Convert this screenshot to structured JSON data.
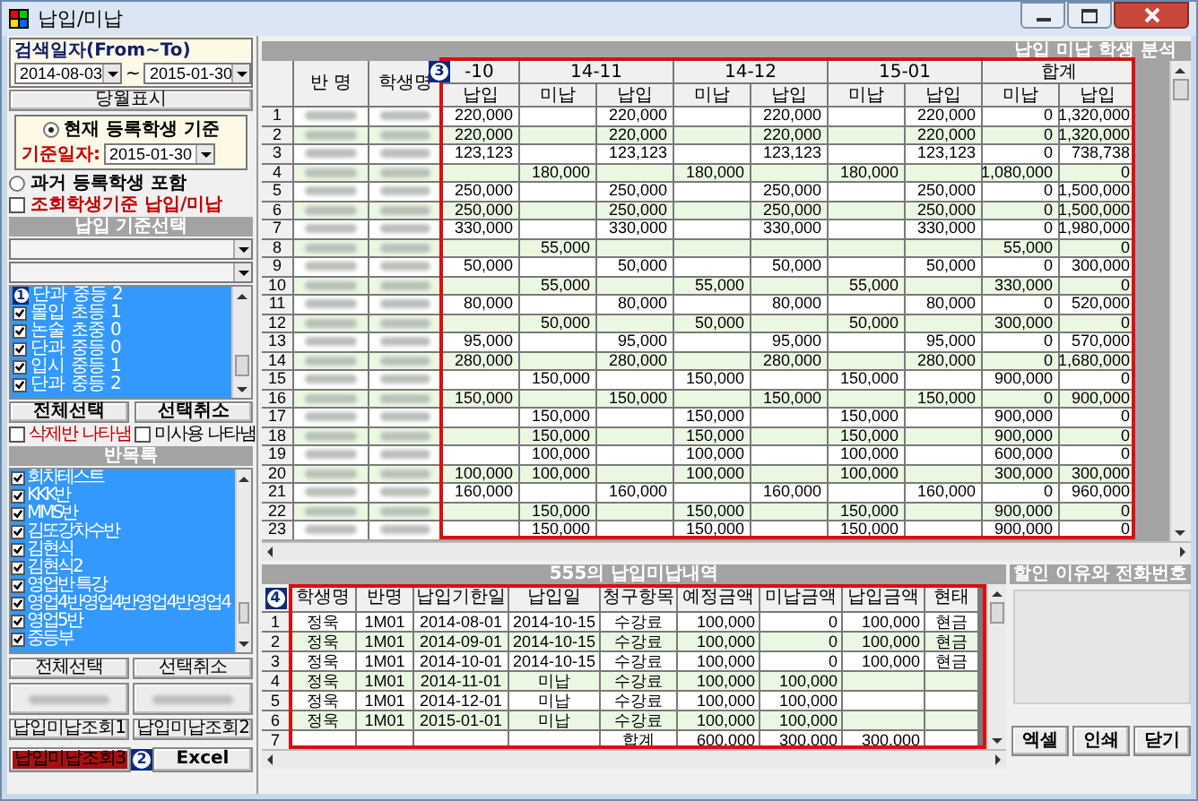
{
  "window": {
    "title": "납입/미납"
  },
  "search": {
    "label": "검색일자(From~To)",
    "from": "2014-08-03",
    "separator": "~",
    "to": "2015-01-30"
  },
  "month_button": "당월표시",
  "criteria": {
    "current": {
      "label": "현재 등록학생 기준",
      "selected": true
    },
    "date_label": "기준일자:",
    "date": "2015-01-30"
  },
  "past": {
    "label": "과거 등록학생 포함",
    "selected": false
  },
  "query_check": {
    "label": "조회학생기준 납입/미납",
    "checked": false
  },
  "payment_header": "납입 기준선택",
  "course_list": {
    "marker": "1",
    "items": [
      {
        "label": "단과 중등 2"
      },
      {
        "label": "몰입 초등 1",
        "checked": true
      },
      {
        "label": "논술 초중 0",
        "checked": true
      },
      {
        "label": "단과 중등 0",
        "checked": true
      },
      {
        "label": "입시 중등 1",
        "checked": true
      },
      {
        "label": "단과 중등 2",
        "checked": true
      }
    ]
  },
  "course_buttons": [
    "전체선택",
    "선택취소"
  ],
  "show_options": [
    {
      "label": "삭제반 나타냄",
      "checked": false,
      "kind": "warning"
    },
    {
      "label": "미사용 나타냄",
      "checked": false,
      "kind": "normal"
    }
  ],
  "class_header": "반목록",
  "class_list": [
    {
      "label": "회차테스트",
      "checked": true
    },
    {
      "label": "KKK반",
      "checked": true
    },
    {
      "label": "MMS반",
      "checked": true
    },
    {
      "label": "김또강차수반",
      "checked": true
    },
    {
      "label": "김현식",
      "checked": true
    },
    {
      "label": "김현식2",
      "checked": true
    },
    {
      "label": "영업반 특강",
      "checked": true
    },
    {
      "label": "영업4반영업4반영업4반영업4",
      "checked": true
    },
    {
      "label": "영업5반",
      "checked": true
    },
    {
      "label": "중등부",
      "checked": true
    }
  ],
  "class_buttons": [
    {
      "label": "전체선택",
      "kind": "normal"
    },
    {
      "label": "선택취소",
      "kind": "normal"
    },
    {
      "kind": "blurred"
    },
    {
      "kind": "blurred"
    },
    {
      "label": "납입미납조회1",
      "kind": "normal"
    },
    {
      "label": "납입미납조회2",
      "kind": "normal"
    }
  ],
  "query_button": "납입미납조회3",
  "excel_marker": "2",
  "excel_button": "Excel",
  "analysis": {
    "title": "납입 미납 학생 분석",
    "marker": "3",
    "fixed_columns": [
      "반 명",
      "학생명"
    ],
    "months": [
      {
        "label": "-10",
        "subs": [
          "납입"
        ]
      },
      {
        "label": "14-11",
        "subs": [
          "미납",
          "납입"
        ]
      },
      {
        "label": "14-12",
        "subs": [
          "미납",
          "납입"
        ]
      },
      {
        "label": "15-01",
        "subs": [
          "미납",
          "납입"
        ]
      },
      {
        "label": "합계",
        "subs": [
          "미납",
          "납입"
        ]
      }
    ],
    "rows": [
      [
        "1",
        [
          "220,000",
          null,
          "220,000",
          null,
          "220,000",
          null,
          "220,000",
          "0",
          "1,320,000"
        ]
      ],
      [
        "2",
        [
          "220,000",
          null,
          "220,000",
          null,
          "220,000",
          null,
          "220,000",
          "0",
          "1,320,000"
        ]
      ],
      [
        "3",
        [
          "123,123",
          null,
          "123,123",
          null,
          "123,123",
          null,
          "123,123",
          "0",
          "738,738"
        ]
      ],
      [
        "4",
        [
          null,
          "180,000",
          null,
          "180,000",
          null,
          "180,000",
          null,
          "1,080,000",
          "0"
        ]
      ],
      [
        "5",
        [
          "250,000",
          null,
          "250,000",
          null,
          "250,000",
          null,
          "250,000",
          "0",
          "1,500,000"
        ]
      ],
      [
        "6",
        [
          "250,000",
          null,
          "250,000",
          null,
          "250,000",
          null,
          "250,000",
          "0",
          "1,500,000"
        ]
      ],
      [
        "7",
        [
          "330,000",
          null,
          "330,000",
          null,
          "330,000",
          null,
          "330,000",
          "0",
          "1,980,000"
        ]
      ],
      [
        "8",
        [
          null,
          "55,000",
          null,
          null,
          null,
          null,
          null,
          "55,000",
          "0"
        ]
      ],
      [
        "9",
        [
          "50,000",
          null,
          "50,000",
          null,
          "50,000",
          null,
          "50,000",
          "0",
          "300,000"
        ]
      ],
      [
        "10",
        [
          null,
          "55,000",
          null,
          "55,000",
          null,
          "55,000",
          null,
          "330,000",
          "0"
        ]
      ],
      [
        "11",
        [
          "80,000",
          null,
          "80,000",
          null,
          "80,000",
          null,
          "80,000",
          "0",
          "520,000"
        ]
      ],
      [
        "12",
        [
          null,
          "50,000",
          null,
          "50,000",
          null,
          "50,000",
          null,
          "300,000",
          "0"
        ]
      ],
      [
        "13",
        [
          "95,000",
          null,
          "95,000",
          null,
          "95,000",
          null,
          "95,000",
          "0",
          "570,000"
        ]
      ],
      [
        "14",
        [
          "280,000",
          null,
          "280,000",
          null,
          "280,000",
          null,
          "280,000",
          "0",
          "1,680,000"
        ]
      ],
      [
        "15",
        [
          null,
          "150,000",
          null,
          "150,000",
          null,
          "150,000",
          null,
          "900,000",
          "0"
        ]
      ],
      [
        "16",
        [
          "150,000",
          null,
          "150,000",
          null,
          "150,000",
          null,
          "150,000",
          "0",
          "900,000"
        ]
      ],
      [
        "17",
        [
          null,
          "150,000",
          null,
          "150,000",
          null,
          "150,000",
          null,
          "900,000",
          "0"
        ]
      ],
      [
        "18",
        [
          null,
          "150,000",
          null,
          "150,000",
          null,
          "150,000",
          null,
          "900,000",
          "0"
        ]
      ],
      [
        "19",
        [
          null,
          "100,000",
          null,
          "100,000",
          null,
          "100,000",
          null,
          "600,000",
          "0"
        ]
      ],
      [
        "20",
        [
          "100,000",
          "100,000",
          null,
          "100,000",
          null,
          "100,000",
          null,
          "300,000",
          "300,000"
        ]
      ],
      [
        "21",
        [
          "160,000",
          null,
          "160,000",
          null,
          "160,000",
          null,
          "160,000",
          "0",
          "960,000"
        ]
      ],
      [
        "22",
        [
          null,
          "150,000",
          null,
          "150,000",
          null,
          "150,000",
          null,
          "900,000",
          "0"
        ]
      ],
      [
        "23",
        [
          null,
          "150,000",
          null,
          "150,000",
          null,
          "150,000",
          null,
          "900,000",
          "0"
        ]
      ]
    ]
  },
  "detail": {
    "title": "555의 납입미납내역",
    "marker": "4",
    "columns": [
      "학생명",
      "반명",
      "납입기한일",
      "납입일",
      "청구항목",
      "예정금액",
      "미납금액",
      "납입금액",
      "현태"
    ],
    "rows": [
      {
        "no": "1",
        "cells": [
          "정욱",
          "1M01",
          "2014-08-01",
          "2014-10-15",
          "수강료",
          "100,000",
          "0",
          "100,000",
          "현금"
        ]
      },
      {
        "no": "2",
        "cells": [
          "정욱",
          "1M01",
          "2014-09-01",
          "2014-10-15",
          "수강료",
          "100,000",
          "0",
          "100,000",
          "현금"
        ]
      },
      {
        "no": "3",
        "cells": [
          "정욱",
          "1M01",
          "2014-10-01",
          "2014-10-15",
          "수강료",
          "100,000",
          "0",
          "100,000",
          "현금"
        ]
      },
      {
        "no": "4",
        "cells": [
          "정욱",
          "1M01",
          "2014-11-01",
          "미납",
          "수강료",
          "100,000",
          "100,000",
          null,
          null
        ]
      },
      {
        "no": "5",
        "cells": [
          "정욱",
          "1M01",
          "2014-12-01",
          "미납",
          "수강료",
          "100,000",
          "100,000",
          null,
          null
        ]
      },
      {
        "no": "6",
        "cells": [
          "정욱",
          "1M01",
          "2015-01-01",
          "미납",
          "수강료",
          "100,000",
          "100,000",
          null,
          null
        ]
      },
      {
        "no": "7",
        "cells": [
          null,
          null,
          null,
          null,
          "합계",
          "600,000",
          "300,000",
          "300,000",
          null
        ]
      }
    ]
  },
  "side_title": "할인 이유와 전화번호",
  "actions": [
    "엑셀",
    "인쇄",
    "닫기"
  ]
}
